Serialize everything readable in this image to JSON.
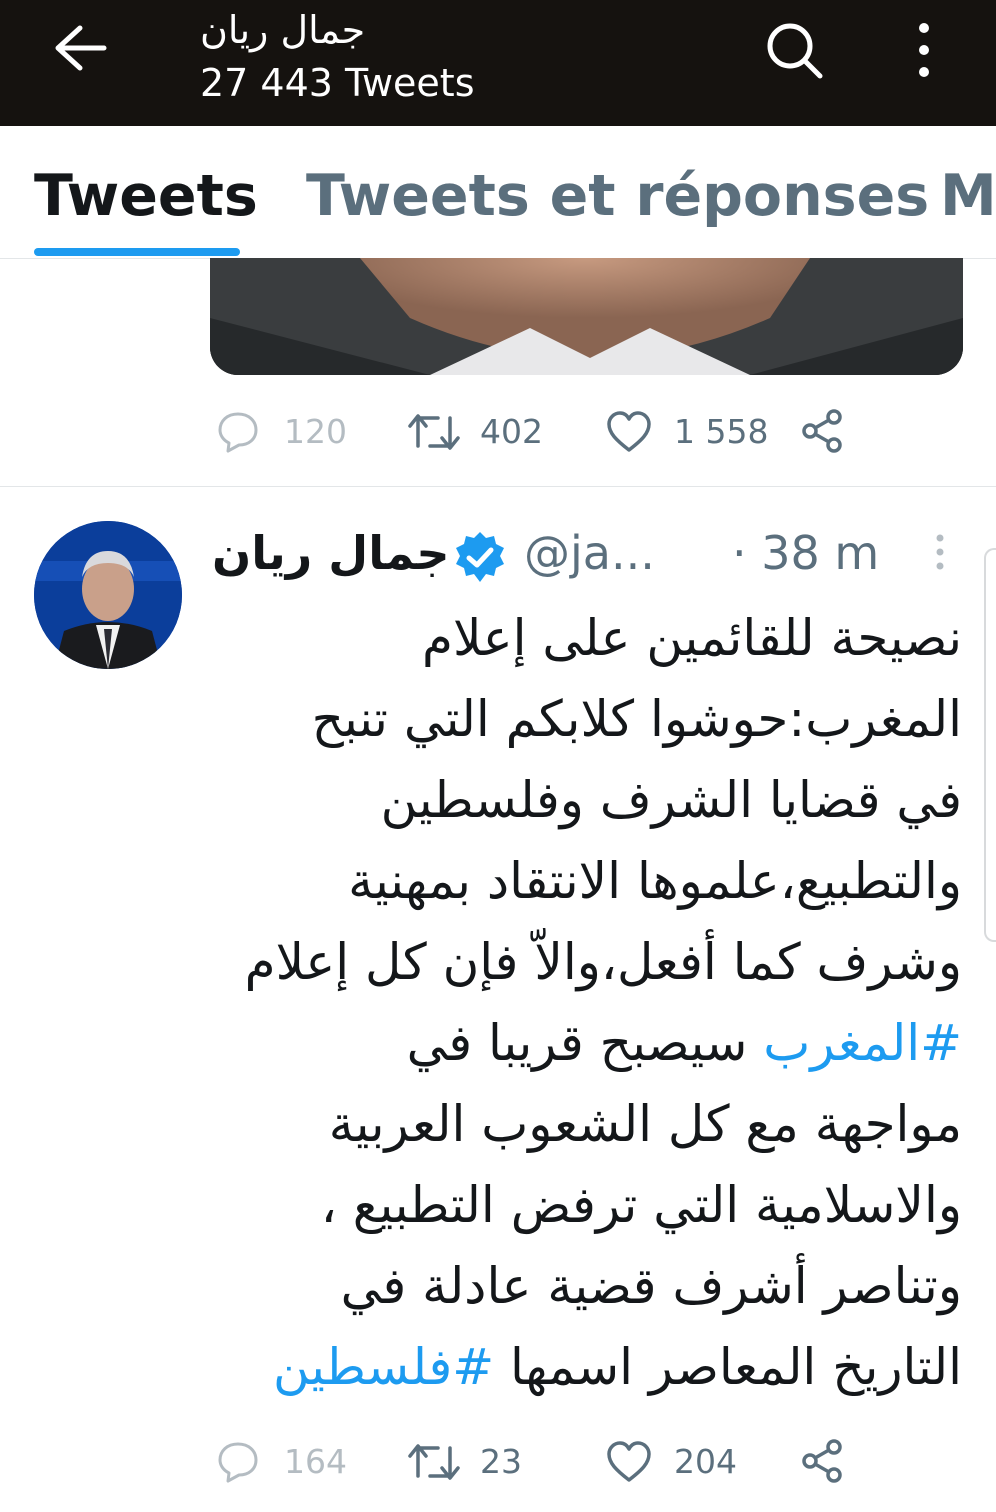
{
  "header": {
    "title": "جمال ريان",
    "tweet_count": "27 443 Tweets",
    "icons": [
      "back-arrow-icon",
      "search-icon",
      "more-vertical-icon"
    ]
  },
  "tabs": [
    {
      "label": "Tweets",
      "active": true
    },
    {
      "label": "Tweets et réponses",
      "active": false
    },
    {
      "label": "M",
      "active": false
    }
  ],
  "previous_tweet": {
    "replies": "120",
    "retweets": "402",
    "likes": "1 558"
  },
  "tweet": {
    "author_name": "جمال ريان",
    "handle": "@ja...",
    "time": "· 38 m",
    "body_lines": [
      "نصيحة للقائمين على إعلام",
      "المغرب:حوشوا كلابكم التي تنبح",
      "في قضايا الشرف وفلسطين",
      "والتطبيع،علموها الانتقاد بمهنية",
      "وشرف كما أفعل،والاّ فإن كل إعلام"
    ],
    "hashtag_1": "#المغرب",
    "line6_text": " سيصبح قريبا في",
    "body_lines_2": [
      "مواجهة مع كل الشعوب العربية",
      "والاسلامية التي ترفض التطبيع ،",
      "وتناصر أشرف قضية عادلة في"
    ],
    "line10_text": "التاريخ المعاصر اسمها ",
    "hashtag_2": "#فلسطين",
    "replies": "164",
    "retweets": "23",
    "likes": "204"
  },
  "colors": {
    "header_bg": "#15120f",
    "accent": "#1d9bf0",
    "text_primary": "#14171a",
    "text_secondary": "#5b6f7d"
  }
}
